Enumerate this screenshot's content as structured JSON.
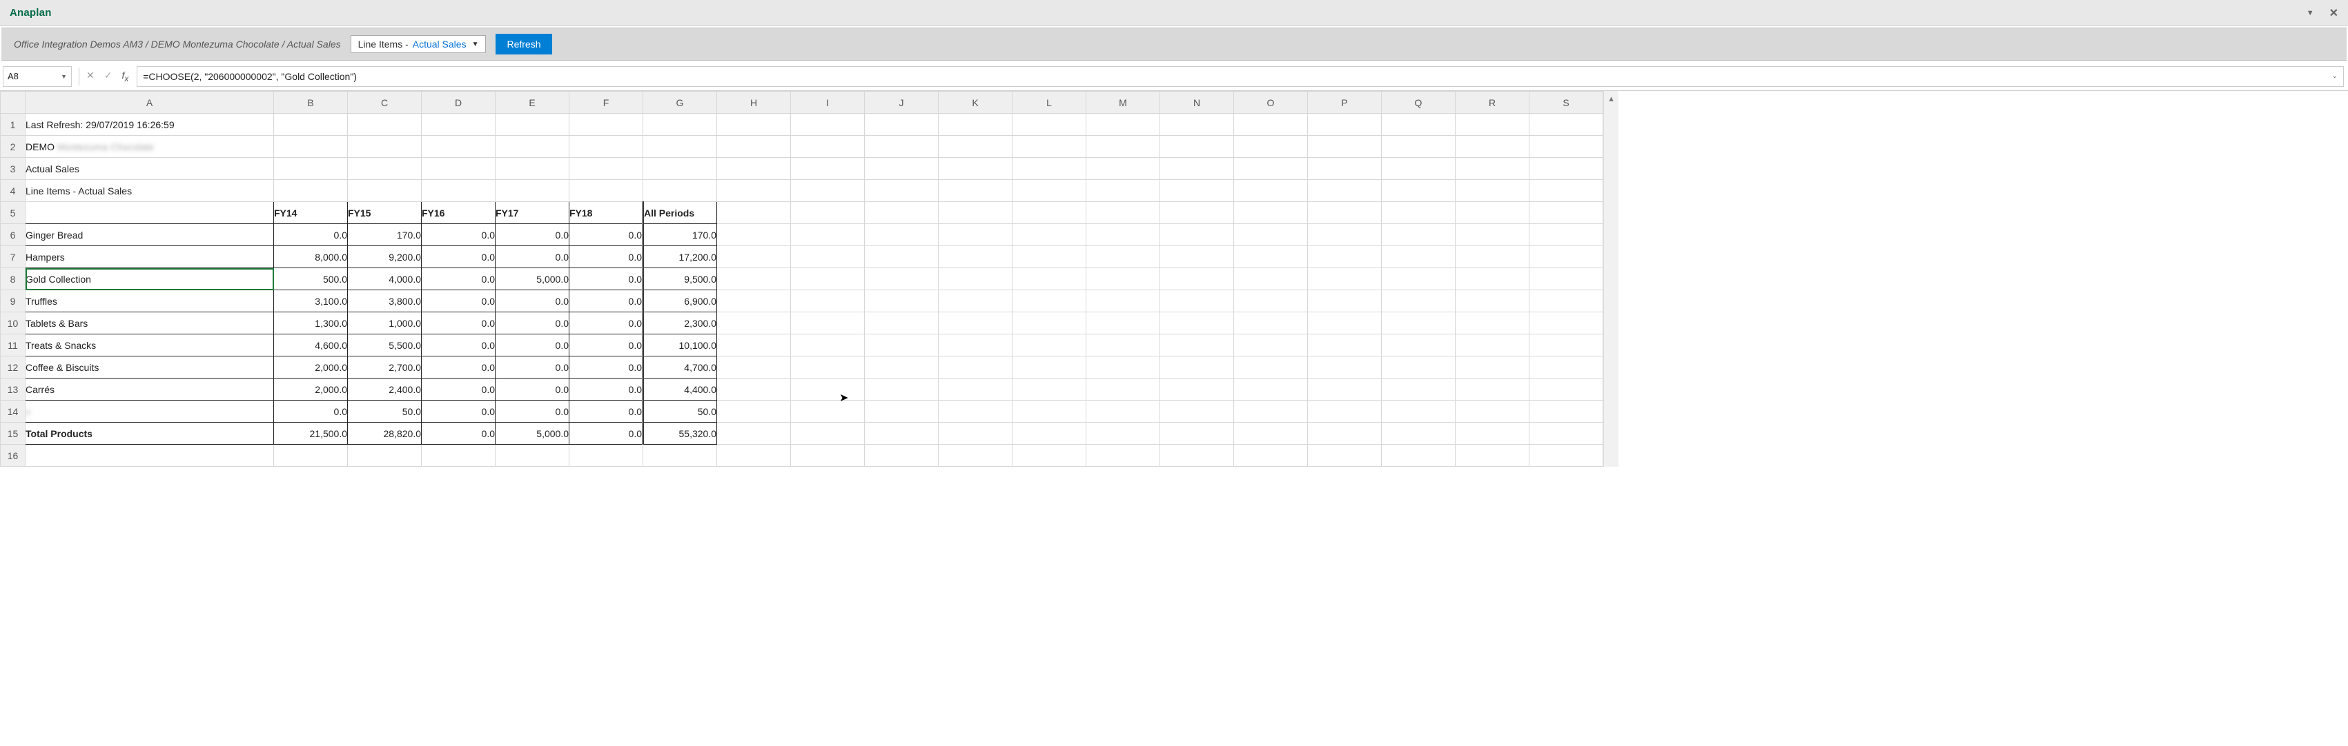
{
  "app": {
    "name": "Anaplan"
  },
  "breadcrumb": "Office Integration Demos AM3 / DEMO Montezuma Chocolate / Actual Sales",
  "line_item_selector": {
    "prefix": "Line Items -",
    "value": "Actual Sales"
  },
  "refresh_label": "Refresh",
  "namebox": "A8",
  "formula": "=CHOOSE(2, \"206000000002\", \"Gold Collection\")",
  "columns": [
    "A",
    "B",
    "C",
    "D",
    "E",
    "F",
    "G",
    "H",
    "I",
    "J",
    "K",
    "L",
    "M",
    "N",
    "O",
    "P",
    "Q",
    "R",
    "S"
  ],
  "meta_rows": {
    "last_refresh": "Last Refresh: 29/07/2019 16:26:59",
    "model": "DEMO Montezuma Chocolate",
    "module": "Actual Sales",
    "line_items": "Line Items - Actual Sales"
  },
  "periods": [
    "FY14",
    "FY15",
    "FY16",
    "FY17",
    "FY18",
    "All Periods"
  ],
  "products": [
    {
      "name": "Ginger Bread",
      "values": [
        "0.0",
        "170.0",
        "0.0",
        "0.0",
        "0.0",
        "170.0"
      ]
    },
    {
      "name": "Hampers",
      "values": [
        "8,000.0",
        "9,200.0",
        "0.0",
        "0.0",
        "0.0",
        "17,200.0"
      ]
    },
    {
      "name": "Gold Collection",
      "values": [
        "500.0",
        "4,000.0",
        "0.0",
        "5,000.0",
        "0.0",
        "9,500.0"
      ]
    },
    {
      "name": "Truffles",
      "values": [
        "3,100.0",
        "3,800.0",
        "0.0",
        "0.0",
        "0.0",
        "6,900.0"
      ]
    },
    {
      "name": "Tablets & Bars",
      "values": [
        "1,300.0",
        "1,000.0",
        "0.0",
        "0.0",
        "0.0",
        "2,300.0"
      ]
    },
    {
      "name": "Treats & Snacks",
      "values": [
        "4,600.0",
        "5,500.0",
        "0.0",
        "0.0",
        "0.0",
        "10,100.0"
      ]
    },
    {
      "name": "Coffee & Biscuits",
      "values": [
        "2,000.0",
        "2,700.0",
        "0.0",
        "0.0",
        "0.0",
        "4,700.0"
      ]
    },
    {
      "name": "Carrés",
      "values": [
        "2,000.0",
        "2,400.0",
        "0.0",
        "0.0",
        "0.0",
        "4,400.0"
      ]
    },
    {
      "name": "v",
      "values": [
        "0.0",
        "50.0",
        "0.0",
        "0.0",
        "0.0",
        "50.0"
      ]
    }
  ],
  "total_row": {
    "name": "Total Products",
    "values": [
      "21,500.0",
      "28,820.0",
      "0.0",
      "5,000.0",
      "0.0",
      "55,320.0"
    ]
  },
  "row_numbers_total": 16
}
